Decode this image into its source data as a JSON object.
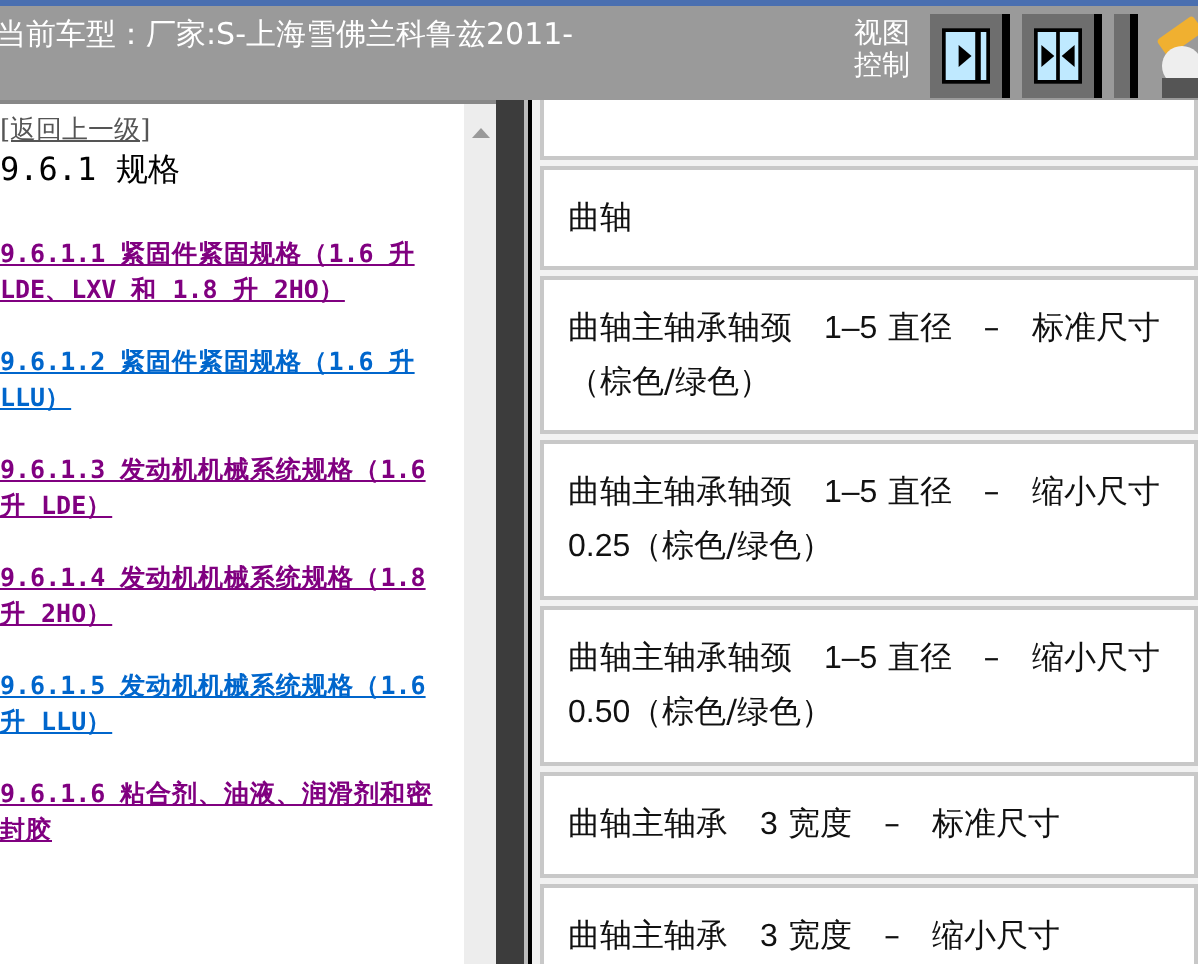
{
  "header": {
    "title": "当前车型：厂家:S-上海雪佛兰科鲁兹2011-",
    "view_control_label": "视图控制"
  },
  "left_pane": {
    "back_link": "[返回上一级]",
    "heading": "9.6.1 规格",
    "links": [
      {
        "number": "9.6.1.1",
        "title": "紧固件紧固规格（1.6 升 LDE、LXV 和 1.8 升 2HO）",
        "visited": true
      },
      {
        "number": "9.6.1.2",
        "title": "紧固件紧固规格（1.6 升 LLU）",
        "visited": false
      },
      {
        "number": "9.6.1.3",
        "title": "发动机机械系统规格（1.6 升 LDE）",
        "visited": true
      },
      {
        "number": "9.6.1.4",
        "title": "发动机机械系统规格（1.8 升 2HO）",
        "visited": true
      },
      {
        "number": "9.6.1.5",
        "title": "发动机机械系统规格（1.6 升 LLU）",
        "visited": false
      },
      {
        "number": "9.6.1.6",
        "title": "粘合剂、油液、润滑剂和密封胶",
        "visited": true
      }
    ]
  },
  "right_pane": {
    "rows": [
      "曲轴",
      "曲轴主轴承轴颈　**1–5** 直径　–　标准尺寸（棕色/绿色）",
      "曲轴主轴承轴颈　**1–5** 直径　–　缩小尺寸　**0.25**（棕色/绿色）",
      "曲轴主轴承轴颈　**1–5** 直径　–　缩小尺寸　**0.50**（棕色/绿色）",
      "曲轴主轴承　**3** 宽度　–　标准尺寸",
      "曲轴主轴承　**3** 宽度　–　缩小尺寸"
    ]
  }
}
